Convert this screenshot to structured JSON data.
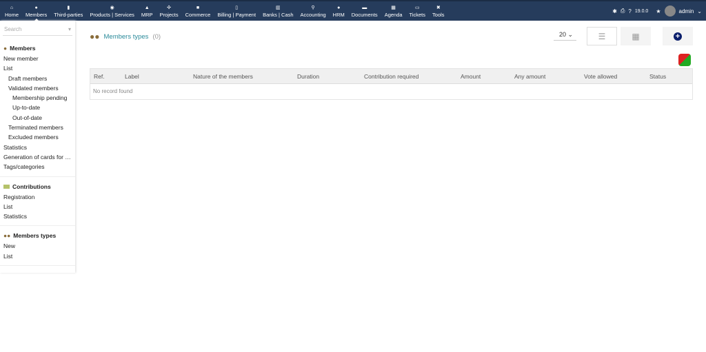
{
  "topnav": {
    "items": [
      {
        "label": "Home",
        "icon": "home-icon"
      },
      {
        "label": "Members",
        "icon": "user-icon",
        "active": true
      },
      {
        "label": "Third-parties",
        "icon": "building-icon"
      },
      {
        "label": "Products | Services",
        "icon": "cube-icon"
      },
      {
        "label": "MRP",
        "icon": "cubes-icon"
      },
      {
        "label": "Projects",
        "icon": "project-icon"
      },
      {
        "label": "Commerce",
        "icon": "briefcase-icon"
      },
      {
        "label": "Billing | Payment",
        "icon": "invoice-icon"
      },
      {
        "label": "Banks | Cash",
        "icon": "bank-icon"
      },
      {
        "label": "Accounting",
        "icon": "search-dollar-icon"
      },
      {
        "label": "HRM",
        "icon": "user-tie-icon"
      },
      {
        "label": "Documents",
        "icon": "folder-icon"
      },
      {
        "label": "Agenda",
        "icon": "calendar-icon"
      },
      {
        "label": "Tickets",
        "icon": "ticket-icon"
      },
      {
        "label": "Tools",
        "icon": "tools-icon"
      }
    ],
    "version": "19.0.0",
    "user": "admin"
  },
  "sidebar": {
    "search_placeholder": "Search",
    "members": {
      "title": "Members",
      "items": [
        {
          "label": "New member",
          "depth": 0
        },
        {
          "label": "List",
          "depth": 0
        },
        {
          "label": "Draft members",
          "depth": 1
        },
        {
          "label": "Validated members",
          "depth": 1
        },
        {
          "label": "Membership pending",
          "depth": 2
        },
        {
          "label": "Up-to-date",
          "depth": 2
        },
        {
          "label": "Out-of-date",
          "depth": 2
        },
        {
          "label": "Terminated members",
          "depth": 1
        },
        {
          "label": "Excluded members",
          "depth": 1
        },
        {
          "label": "Statistics",
          "depth": 0
        },
        {
          "label": "Generation of cards for m...",
          "depth": 0
        },
        {
          "label": "Tags/categories",
          "depth": 0
        }
      ]
    },
    "contributions": {
      "title": "Contributions",
      "items": [
        {
          "label": "Registration"
        },
        {
          "label": "List"
        },
        {
          "label": "Statistics"
        }
      ]
    },
    "types": {
      "title": "Members types",
      "items": [
        {
          "label": "New"
        },
        {
          "label": "List"
        }
      ]
    }
  },
  "main": {
    "title": "Members types",
    "count": "(0)",
    "page_size": "20",
    "columns": [
      "Ref.",
      "Label",
      "Nature of the members",
      "Duration",
      "Contribution required",
      "Amount",
      "Any amount",
      "Vote allowed",
      "Status"
    ],
    "empty": "No record found"
  }
}
